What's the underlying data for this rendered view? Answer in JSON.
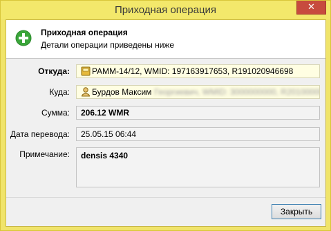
{
  "window": {
    "title": "Приходная операция",
    "close_glyph": "✕",
    "frame_color": "#f0e46a"
  },
  "header": {
    "title": "Приходная операция",
    "subtitle": "Детали операции приведены ниже",
    "icon": "add-icon"
  },
  "form": {
    "from": {
      "label": "Откуда:",
      "value": "PAMM-14/12, WMID: 197163917653, R191020946698",
      "icon": "wallet-icon"
    },
    "to": {
      "label": "Куда:",
      "value": "Бурдов Максим",
      "redacted": "Георгиевич, WMID: 3000000000, R201000000000",
      "icon": "user-icon"
    },
    "amount": {
      "label": "Сумма:",
      "value": "206.12 WMR"
    },
    "date": {
      "label": "Дата перевода:",
      "value": "25.05.15 06:44"
    },
    "note": {
      "label": "Примечание:",
      "value": "densis 4340"
    }
  },
  "footer": {
    "close_label": "Закрыть"
  }
}
